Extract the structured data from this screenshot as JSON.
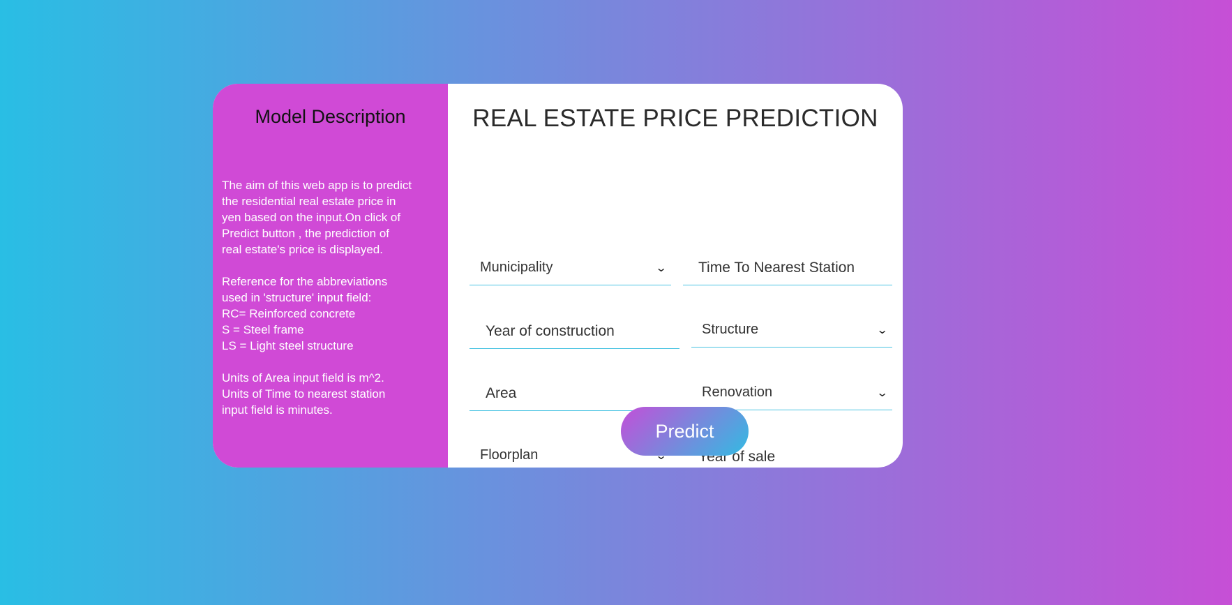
{
  "sidebar": {
    "title": "Model Description",
    "paragraphs": [
      [
        "The aim of this web app is to predict",
        "the residential real estate price in",
        "yen based on the input.On click of",
        "Predict button , the prediction of",
        "real estate's price is displayed."
      ],
      [
        "Reference for the abbreviations",
        "used in 'structure' input field:",
        "RC= Reinforced concrete",
        "S = Steel frame",
        "LS = Light steel structure"
      ],
      [
        "Units of Area input field is m^2.",
        "Units of Time to nearest station",
        "input field is minutes."
      ]
    ]
  },
  "form": {
    "title": "REAL ESTATE PRICE PREDICTION",
    "municipality": "Municipality",
    "time_to_station": "Time To Nearest Station",
    "year_construction": "Year of construction",
    "structure": "Structure",
    "area": "Area",
    "renovation": "Renovation",
    "floorplan": "Floorplan",
    "year_sale": "Year of sale",
    "predict_label": "Predict",
    "chevron": "⌄"
  }
}
